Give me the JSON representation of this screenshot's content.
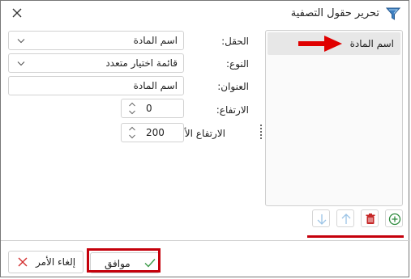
{
  "title": "تحرير حقول التصفية",
  "list": {
    "items": [
      {
        "label": "اسم المادة"
      }
    ]
  },
  "form": {
    "field_label": "الحقل:",
    "field_value": "اسم المادة",
    "type_label": "النوع:",
    "type_value": "قائمة اختيار متعدد",
    "caption_label": "العنوان:",
    "caption_value": "اسم المادة",
    "height_label": "الارتفاع:",
    "height_value": "0",
    "maxheight_label": "الارتفاع الأعظمي:",
    "maxheight_value": "200"
  },
  "buttons": {
    "ok_label": "موافق",
    "cancel_label": "إلغاء الأمر"
  },
  "icons": {
    "title": "filter-icon",
    "close": "close-icon",
    "add": "add-icon",
    "delete": "delete-icon",
    "move_up": "arrow-up-icon",
    "move_down": "arrow-down-icon",
    "ok": "checkmark-icon",
    "cancel": "cross-icon"
  },
  "colors": {
    "annotation_red": "#c5000b",
    "add_green": "#2e8b3e",
    "delete_red": "#c62828",
    "disabled_arrow_blue": "#9cc4e6",
    "ok_check_green": "#3a9b47"
  }
}
